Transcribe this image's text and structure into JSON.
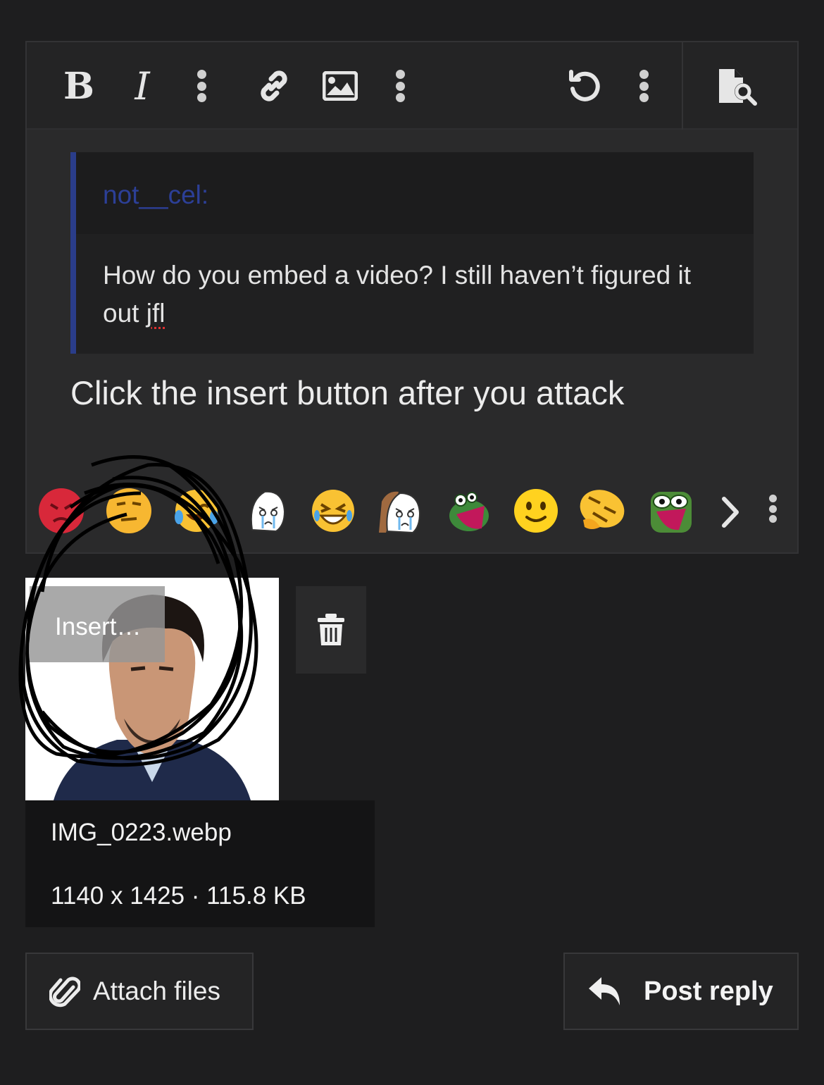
{
  "toolbar": {
    "bold_label": "B",
    "italic_label": "I"
  },
  "quote": {
    "author": "not__cel:",
    "body_main": "How do you embed a video? I still haven’t figured it out ",
    "body_misspelled": "jfl"
  },
  "reply": {
    "text": "Click the insert button after you attack"
  },
  "emojis": [
    "angry",
    "neutral",
    "crying-laughing",
    "wojak-crying",
    "cringe-grin",
    "wojak-crying-hooded",
    "frog-screaming",
    "slight-smile",
    "thinking-tilted",
    "pepe-screaming"
  ],
  "attachment": {
    "insert_label": "Insert…",
    "file_name": "IMG_0223.webp",
    "file_meta": "1140 x 1425 · 115.8 KB"
  },
  "actions": {
    "attach_label": "Attach files",
    "post_label": "Post reply"
  },
  "colors": {
    "background": "#1e1e1f",
    "quote_accent": "#2a3d8a",
    "quote_author": "#2c3f97"
  }
}
